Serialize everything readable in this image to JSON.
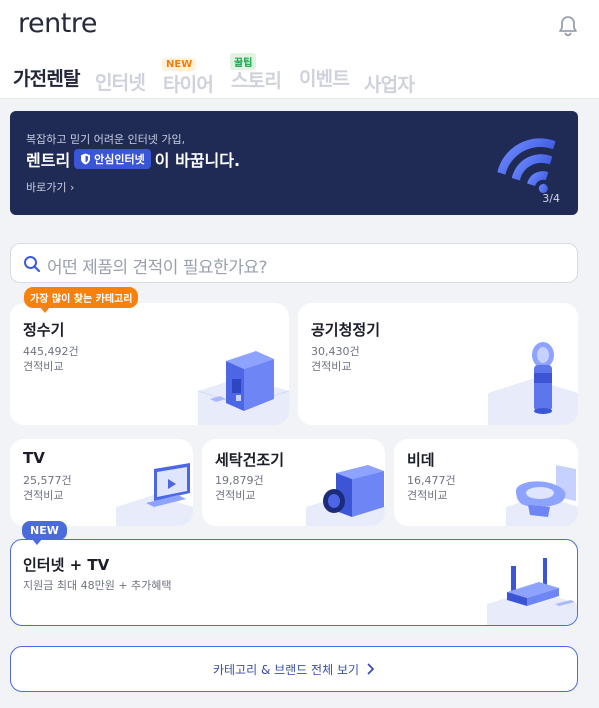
{
  "header": {
    "logo": "rentre",
    "nav": [
      {
        "label": "가전렌탈",
        "active": true
      },
      {
        "label": "인터넷",
        "active": false
      },
      {
        "label": "타이어",
        "active": false,
        "badge": "NEW"
      },
      {
        "label": "스토리",
        "active": false,
        "badge": "꿀팁"
      },
      {
        "label": "이벤트",
        "active": false
      },
      {
        "label": "사업자",
        "active": false
      }
    ]
  },
  "banner": {
    "subtitle": "복잡하고 믿기 어려운 인터넷 가입,",
    "title_prefix": "렌트리",
    "pill_label": "안심인터넷",
    "title_suffix": "이 바꿉니다.",
    "link": "바로가기",
    "pager": "3/4"
  },
  "search": {
    "placeholder": "어떤 제품의 견적이 필요한가요?"
  },
  "categories": {
    "hot_badge": "가장 많이 찾는 카테고리",
    "items": [
      {
        "title": "정수기",
        "count": "445,492건",
        "compare": "견적비교"
      },
      {
        "title": "공기청정기",
        "count": "30,430건",
        "compare": "견적비교"
      },
      {
        "title": "TV",
        "count": "25,577건",
        "compare": "견적비교"
      },
      {
        "title": "세탁건조기",
        "count": "19,879건",
        "compare": "견적비교"
      },
      {
        "title": "비데",
        "count": "16,477건",
        "compare": "견적비교"
      }
    ]
  },
  "bundle": {
    "badge": "NEW",
    "title": "인터넷 + TV",
    "desc": "지원금 최대 48만원 + 추가혜택"
  },
  "all_button": {
    "label": "카테고리 & 브랜드 전체 보기"
  },
  "colors": {
    "accent": "#4a6bd9",
    "banner_bg": "#1f2a55",
    "hot_badge": "#f5820f"
  }
}
